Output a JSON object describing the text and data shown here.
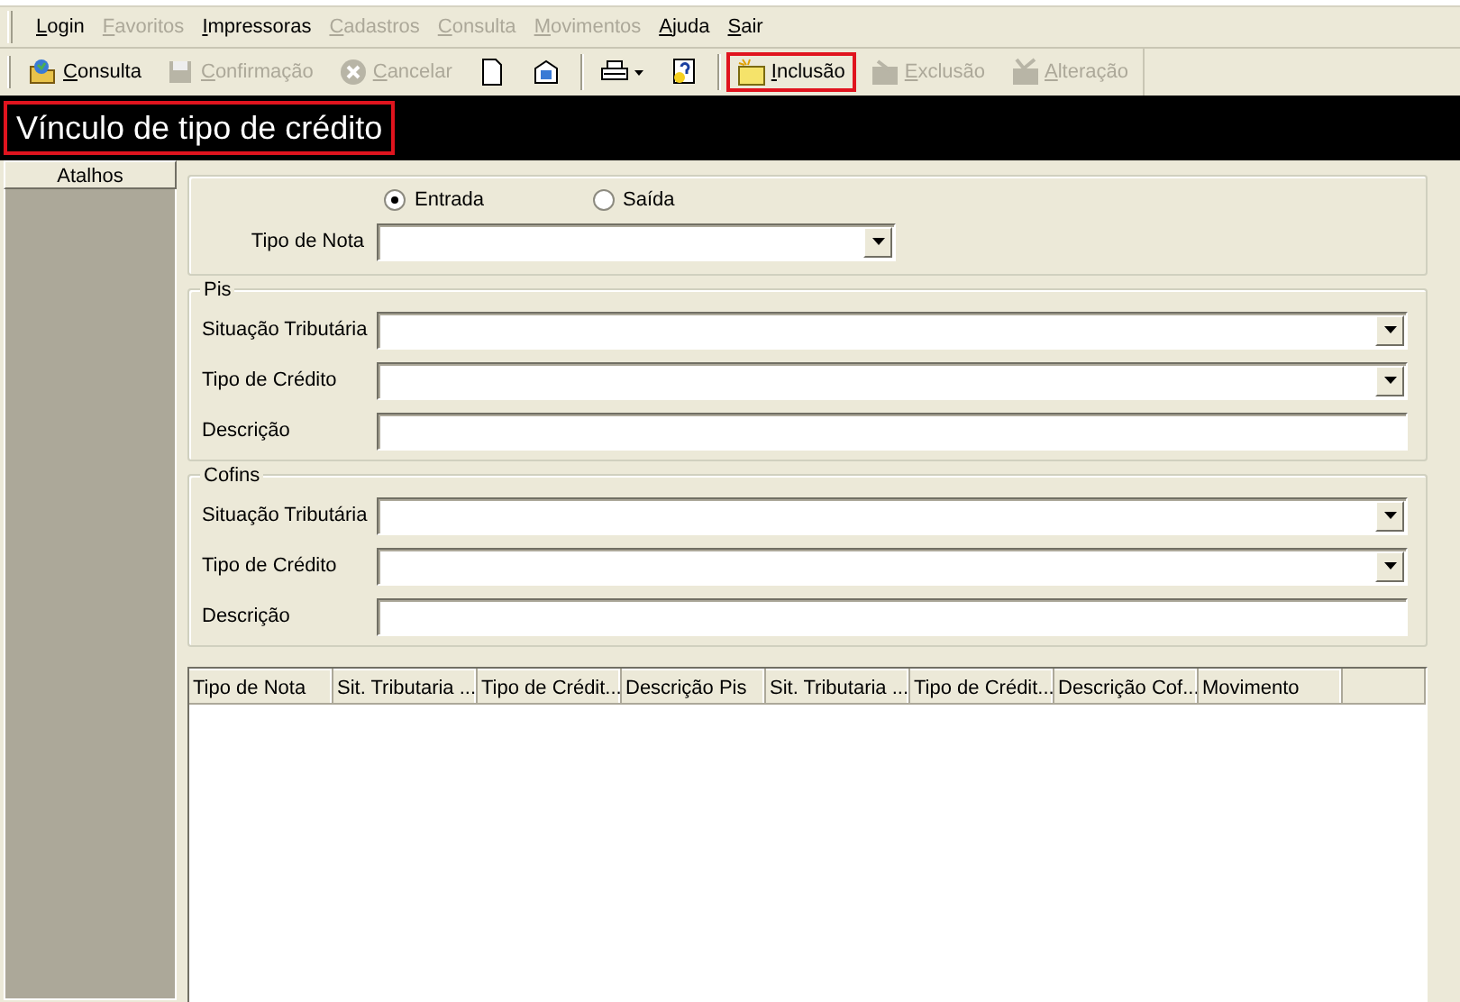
{
  "menu": [
    {
      "label": "Login",
      "disabled": false
    },
    {
      "label": "Favoritos",
      "disabled": true
    },
    {
      "label": "Impressoras",
      "disabled": false
    },
    {
      "label": "Cadastros",
      "disabled": true
    },
    {
      "label": "Consulta",
      "disabled": true
    },
    {
      "label": "Movimentos",
      "disabled": true
    },
    {
      "label": "Ajuda",
      "disabled": false
    },
    {
      "label": "Sair",
      "disabled": false
    }
  ],
  "toolbar": [
    {
      "kind": "button",
      "label": "Consulta",
      "disabled": false,
      "highlighted": false
    },
    {
      "kind": "button",
      "label": "Confirmação",
      "disabled": true,
      "highlighted": false
    },
    {
      "kind": "button",
      "label": "Cancelar",
      "disabled": true,
      "highlighted": false
    },
    {
      "kind": "icon-button"
    },
    {
      "kind": "icon-button"
    },
    {
      "kind": "separator"
    },
    {
      "kind": "dropdown-button"
    },
    {
      "kind": "icon-button"
    },
    {
      "kind": "separator"
    },
    {
      "kind": "button",
      "label": "Inclusão",
      "disabled": false,
      "highlighted": true
    },
    {
      "kind": "button",
      "label": "Exclusão",
      "disabled": true,
      "highlighted": false
    },
    {
      "kind": "button",
      "label": "Alteração",
      "disabled": true,
      "highlighted": false
    }
  ],
  "title": {
    "text": "Vínculo de tipo de crédito",
    "highlighted": true
  },
  "sidebar": {
    "header": "Atalhos"
  },
  "note_type": {
    "options": [
      {
        "label": "Entrada",
        "selected": true
      },
      {
        "label": "Saída",
        "selected": false
      }
    ],
    "label": "Tipo de Nota"
  },
  "groups": [
    {
      "title": "Pis",
      "fields": [
        {
          "label": "Situação Tributária",
          "kind": "select"
        },
        {
          "label": "Tipo de Crédito",
          "kind": "select"
        },
        {
          "label": "Descrição",
          "kind": "text"
        }
      ]
    },
    {
      "title": "Cofins",
      "fields": [
        {
          "label": "Situação Tributária",
          "kind": "select"
        },
        {
          "label": "Tipo de Crédito",
          "kind": "select"
        },
        {
          "label": "Descrição",
          "kind": "text"
        }
      ]
    }
  ],
  "table": {
    "columns": [
      "Tipo de Nota",
      "Sit. Tributaria ...",
      "Tipo de Crédit...",
      "Descrição Pis",
      "Sit. Tributaria ...",
      "Tipo de Crédit...",
      "Descrição Cof...",
      "Movimento"
    ]
  }
}
